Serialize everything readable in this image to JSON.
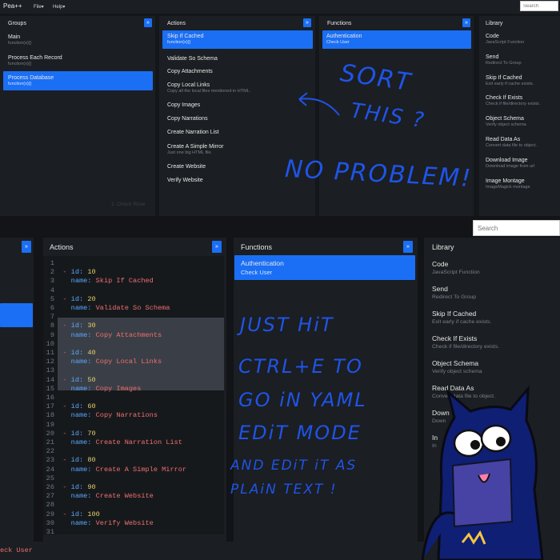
{
  "top": {
    "app_title": "Pea++",
    "menu": [
      "File",
      "Help"
    ],
    "search_placeholder": "Search",
    "groups": {
      "header": "Groups",
      "items": [
        {
          "title": "Main",
          "sub": "function(x){}"
        },
        {
          "title": "Process Each Record",
          "sub": "function(x){}"
        },
        {
          "title": "Process Database",
          "sub": "function(x){}"
        }
      ]
    },
    "actions": {
      "header": "Actions",
      "items": [
        {
          "title": "Skip If Cached",
          "sub": "function(x){}"
        },
        {
          "title": "Validate So Schema",
          "sub": ""
        },
        {
          "title": "Copy Attachments",
          "sub": ""
        },
        {
          "title": "Copy Local Links",
          "sub": "Copy all the local files mentioned in HTML."
        },
        {
          "title": "Copy Images",
          "sub": ""
        },
        {
          "title": "Copy Narrations",
          "sub": ""
        },
        {
          "title": "Create Narration List",
          "sub": ""
        },
        {
          "title": "Create A Simple Mirror",
          "sub": "Just one big HTML file."
        },
        {
          "title": "Create Website",
          "sub": ""
        },
        {
          "title": "Verify Website",
          "sub": ""
        }
      ],
      "ghost": "1. Check Rose"
    },
    "functions": {
      "header": "Functions",
      "items": [
        {
          "title": "Authentication",
          "sub": "Check User"
        }
      ]
    },
    "library": {
      "header": "Library",
      "items": [
        {
          "title": "Code",
          "sub": "JavaScript Function"
        },
        {
          "title": "Send",
          "sub": "Redirect To Group"
        },
        {
          "title": "Skip If Cached",
          "sub": "Exit early if cache exists."
        },
        {
          "title": "Check If Exists",
          "sub": "Check if file/directory exists."
        },
        {
          "title": "Object Schema",
          "sub": "Verify object schema"
        },
        {
          "title": "Read Data As",
          "sub": "Convert data file to object."
        },
        {
          "title": "Download Image",
          "sub": "Download image from url"
        },
        {
          "title": "Image Montage",
          "sub": "ImageMagick montage"
        }
      ]
    },
    "annotations": {
      "line1": "SORT",
      "line2": "THIS ?",
      "line3": "NO PROBLEM!"
    }
  },
  "bottom": {
    "search_placeholder": "Search",
    "actions_header": "Actions",
    "functions_header": "Functions",
    "library_header": "Library",
    "functions": [
      {
        "title": "Authentication",
        "sub": "Check User"
      }
    ],
    "library": [
      {
        "title": "Code",
        "sub": "JavaScript Function"
      },
      {
        "title": "Send",
        "sub": "Redirect To Group"
      },
      {
        "title": "Skip If Cached",
        "sub": "Exit early if cache exists."
      },
      {
        "title": "Check If Exists",
        "sub": "Check if file/directory exists."
      },
      {
        "title": "Object Schema",
        "sub": "Verify object schema"
      },
      {
        "title": "Read Data As",
        "sub": "Convert data file to object."
      },
      {
        "title": "Down",
        "sub": "Down"
      },
      {
        "title": "In",
        "sub": "In"
      }
    ],
    "code_lines": [
      {
        "n": "1"
      },
      {
        "n": "2",
        "id": "10"
      },
      {
        "n": "3",
        "name": "Skip If Cached"
      },
      {
        "n": "4"
      },
      {
        "n": "5",
        "id": "20"
      },
      {
        "n": "6",
        "name": "Validate So Schema"
      },
      {
        "n": "7"
      },
      {
        "n": "8",
        "id": "30"
      },
      {
        "n": "9",
        "name": "Copy Attachments"
      },
      {
        "n": "10"
      },
      {
        "n": "11",
        "id": "40"
      },
      {
        "n": "12",
        "name": "Copy Local Links"
      },
      {
        "n": "13"
      },
      {
        "n": "14",
        "id": "50"
      },
      {
        "n": "15",
        "name": "Copy Images"
      },
      {
        "n": "16"
      },
      {
        "n": "17",
        "id": "60"
      },
      {
        "n": "18",
        "name": "Copy Narrations"
      },
      {
        "n": "19"
      },
      {
        "n": "20",
        "id": "70"
      },
      {
        "n": "21",
        "name": "Create Narration List"
      },
      {
        "n": "22"
      },
      {
        "n": "23",
        "id": "80"
      },
      {
        "n": "24",
        "name": "Create A Simple Mirror"
      },
      {
        "n": "25"
      },
      {
        "n": "26",
        "id": "90"
      },
      {
        "n": "27",
        "name": "Create Website"
      },
      {
        "n": "28"
      },
      {
        "n": "29",
        "id": "100"
      },
      {
        "n": "30",
        "name": "Verify Website"
      },
      {
        "n": "31"
      }
    ],
    "code_tokens": {
      "dash": "-",
      "id_key": "id:",
      "name_key": "name:"
    },
    "bottom_status": "eck User",
    "annotations": {
      "l1": "JUST HiT",
      "l2": "CTRL+E  TO",
      "l3": "GO iN YAML",
      "l4": "EDiT MODE",
      "l5": "AND EDiT iT AS",
      "l6": "PLAiN TEXT !"
    }
  },
  "colors": {
    "accent": "#1a6ff5",
    "background": "#121417",
    "panel": "#1b1e22",
    "annotation_ink": "#1f54e8"
  }
}
